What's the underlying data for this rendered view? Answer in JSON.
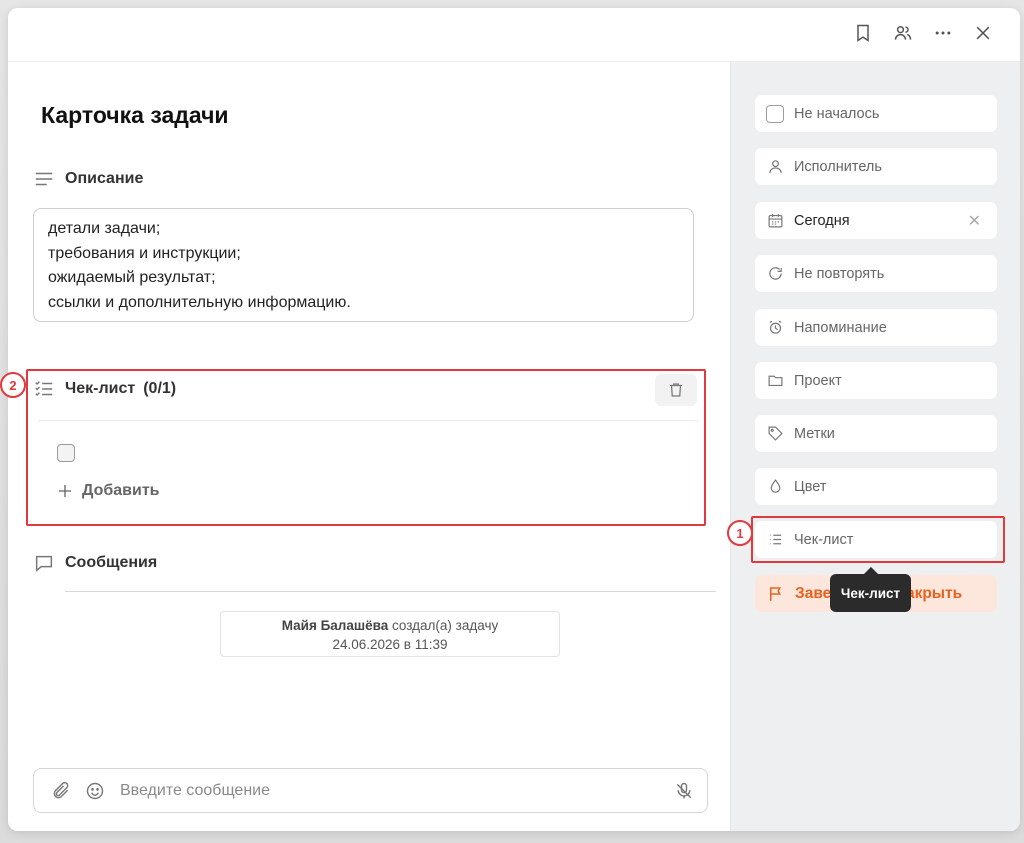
{
  "topbar": {
    "icons": [
      "bookmark-icon",
      "users-icon",
      "more-icon",
      "close-icon"
    ]
  },
  "card": {
    "title": "Карточка задачи",
    "description_label": "Описание",
    "description_lines": [
      "детали задачи;",
      "требования и инструкции;",
      "ожидаемый результат;",
      "ссылки и дополнительную информацию."
    ],
    "checklist": {
      "label": "Чек-лист",
      "count": "(0/1)",
      "add_label": "Добавить"
    },
    "messages": {
      "label": "Сообщения",
      "system_author": "Майя Балашёва",
      "system_text": " создал(а) задачу",
      "system_date": "24.06.2026 в 11:39"
    },
    "compose": {
      "placeholder": "Введите сообщение"
    }
  },
  "sidebar": {
    "items": [
      {
        "label": "Не началось",
        "icon": "checkbox-icon"
      },
      {
        "label": "Исполнитель",
        "icon": "user-icon"
      },
      {
        "label": "Сегодня",
        "icon": "calendar-icon"
      },
      {
        "label": "Не повторять",
        "icon": "repeat-icon"
      },
      {
        "label": "Напоминание",
        "icon": "alarm-icon"
      },
      {
        "label": "Проект",
        "icon": "folder-icon"
      },
      {
        "label": "Метки",
        "icon": "tag-icon"
      },
      {
        "label": "Цвет",
        "icon": "drop-icon"
      },
      {
        "label": "Чек-лист",
        "icon": "list-icon"
      }
    ],
    "finish_label": "Завершить и закрыть",
    "tooltip": "Чек-лист"
  },
  "annotations": {
    "badge_1": "1",
    "badge_2": "2"
  },
  "colors": {
    "highlight": "#e0393e",
    "accent_orange": "#e8621f",
    "sidebar_bg": "#eeeff1"
  }
}
